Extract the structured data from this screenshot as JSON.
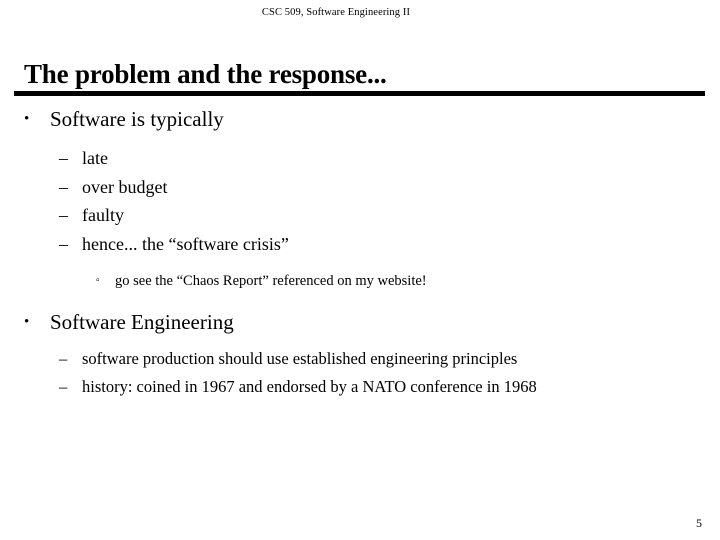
{
  "slide": {
    "running_header": "CSC 509, Software Engineering II",
    "title": "The problem and the response...",
    "page_number": "5",
    "markers": {
      "level1": "•",
      "level2": "–",
      "level3": "▫"
    },
    "bullets": [
      {
        "level": 1,
        "text": "Software is typically"
      },
      {
        "level": 2,
        "text": "late"
      },
      {
        "level": 2,
        "text": "over budget"
      },
      {
        "level": 2,
        "text": "faulty"
      },
      {
        "level": 2,
        "text": "hence... the “software crisis”"
      },
      {
        "level": 3,
        "text": "go see the “Chaos Report” referenced on my website!"
      },
      {
        "level": 1,
        "text": "Software Engineering"
      },
      {
        "level": 2,
        "text": "software production should use established engineering principles"
      },
      {
        "level": 2,
        "text": "history: coined in 1967 and endorsed by a NATO conference in 1968"
      }
    ]
  }
}
